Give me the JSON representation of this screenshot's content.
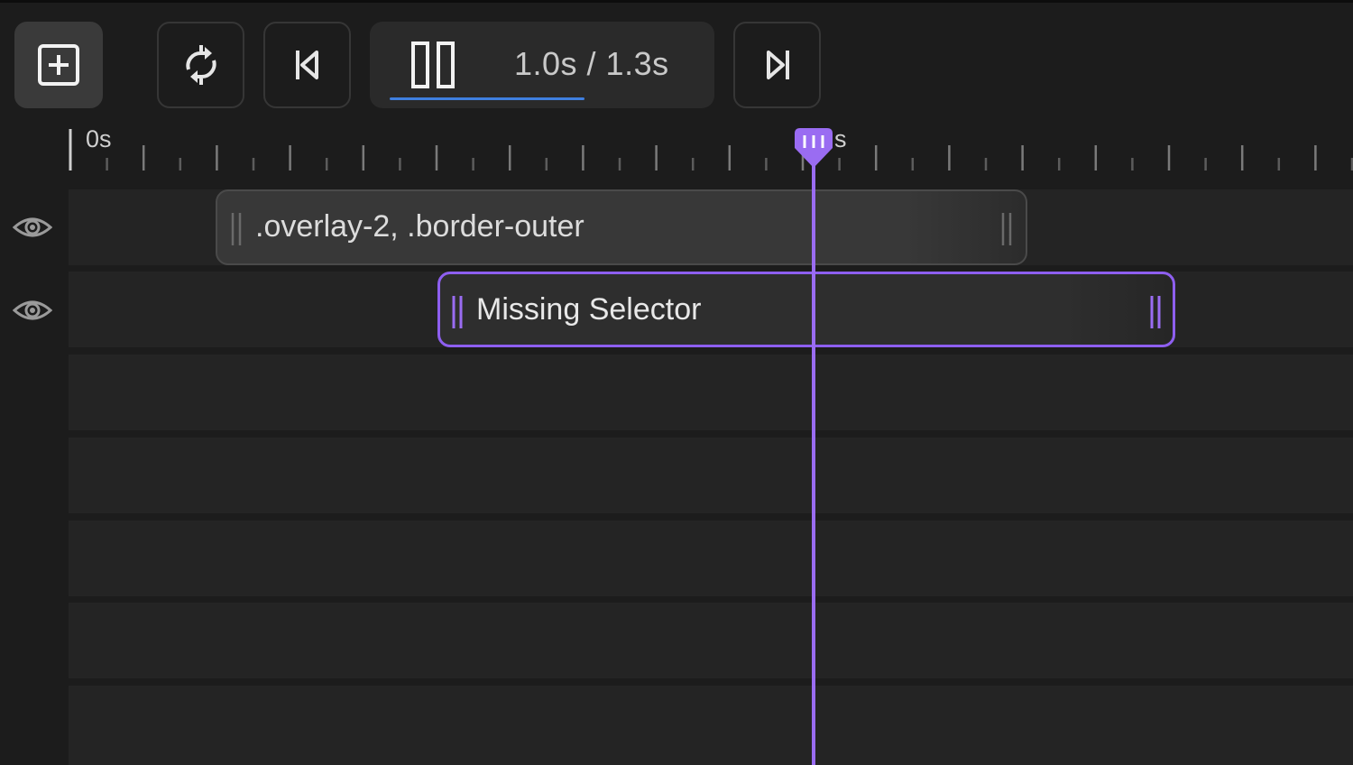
{
  "toolbar": {
    "add_button": {
      "icon": "plus-square-icon"
    },
    "loop_button": {
      "icon": "loop-icon"
    },
    "skip_start_button": {
      "icon": "skip-to-start-icon"
    },
    "pause_button": {
      "icon": "pause-icon"
    },
    "skip_end_button": {
      "icon": "skip-to-end-icon"
    },
    "time_readout": "1.0s / 1.3s",
    "progress_fraction": 0.77,
    "progress_color": "#3f7fe0"
  },
  "ruler": {
    "labels": [
      "0s",
      "s"
    ]
  },
  "playhead": {
    "color": "#9a6cf2",
    "time_seconds": 1.0
  },
  "tracks": [
    {
      "label": ".overlay-2, .border-outer",
      "visible": true,
      "selected": false
    },
    {
      "label": "Missing Selector",
      "visible": true,
      "selected": true,
      "accent": "#8e5ff0"
    }
  ]
}
